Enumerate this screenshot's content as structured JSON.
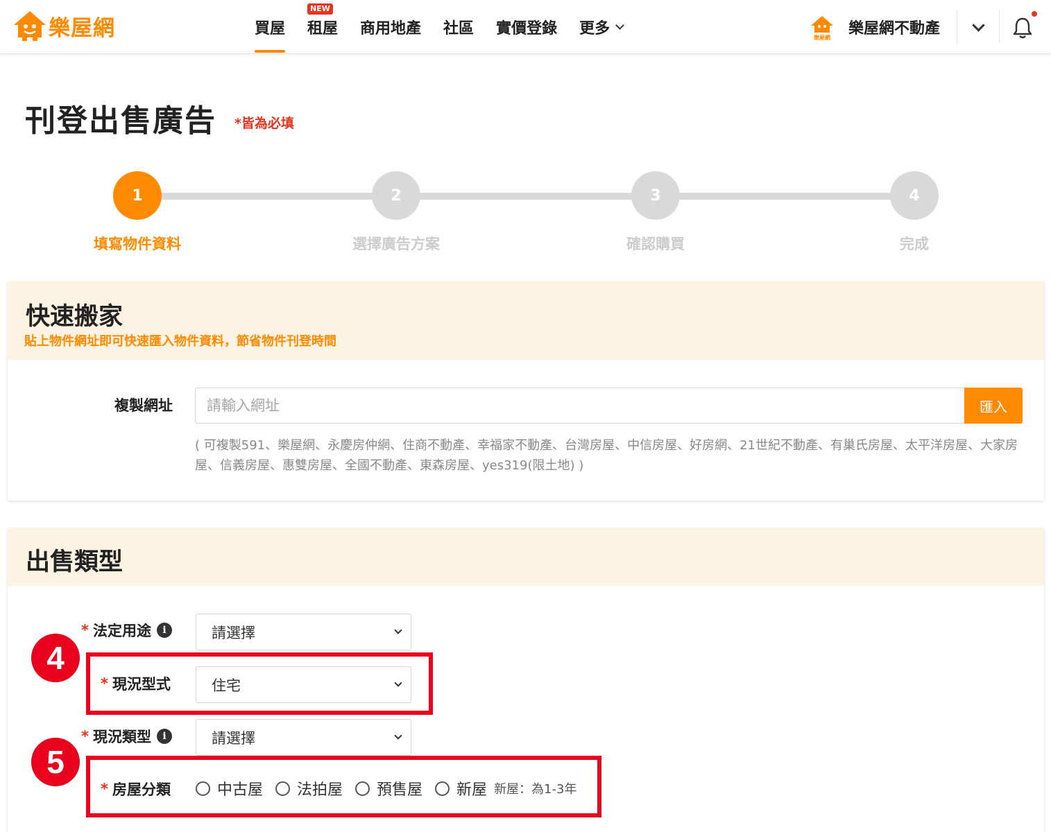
{
  "header": {
    "logo_text": "樂屋網",
    "nav": [
      {
        "label": "買屋",
        "active": true
      },
      {
        "label": "租屋",
        "badge": "NEW"
      },
      {
        "label": "商用地產"
      },
      {
        "label": "社區"
      },
      {
        "label": "實價登錄"
      },
      {
        "label": "更多"
      }
    ],
    "user_avatar_text": "樂屋網",
    "user_name": "樂屋網不動產"
  },
  "page": {
    "title": "刊登出售廣告",
    "required_note": "*皆為必填"
  },
  "steps": [
    {
      "number": "1",
      "label": "填寫物件資料",
      "active": true
    },
    {
      "number": "2",
      "label": "選擇廣告方案",
      "active": false
    },
    {
      "number": "3",
      "label": "確認購買",
      "active": false
    },
    {
      "number": "4",
      "label": "完成",
      "active": false
    }
  ],
  "quick_move": {
    "title": "快速搬家",
    "subtitle": "貼上物件網址即可快速匯入物件資料，節省物件刊登時間",
    "url_label": "複製網址",
    "url_placeholder": "請輸入網址",
    "import_button": "匯入",
    "hint": "( 可複製591、樂屋網、永慶房仲網、住商不動產、幸福家不動產、台灣房屋、中信房屋、好房網、21世紀不動產、有巢氏房屋、太平洋房屋、大家房屋、信義房屋、惠雙房屋、全國不動產、東森房屋、yes319(限土地) )"
  },
  "sale_type": {
    "title": "出售類型",
    "fields": {
      "legal_use": {
        "label": "法定用途",
        "value": "請選擇"
      },
      "current_form": {
        "label": "現況型式",
        "value": "住宅"
      },
      "current_type": {
        "label": "現況類型",
        "value": "請選擇"
      },
      "house_category": {
        "label": "房屋分類",
        "options": [
          "中古屋",
          "法拍屋",
          "預售屋",
          "新屋"
        ],
        "note": "新屋：為1-3年"
      }
    },
    "annotations": [
      "4",
      "5"
    ]
  },
  "colors": {
    "accent": "#ff8a00",
    "required": "#e8341c",
    "annotation": "#e8001c",
    "section_header_bg": "#fdf3e2"
  }
}
